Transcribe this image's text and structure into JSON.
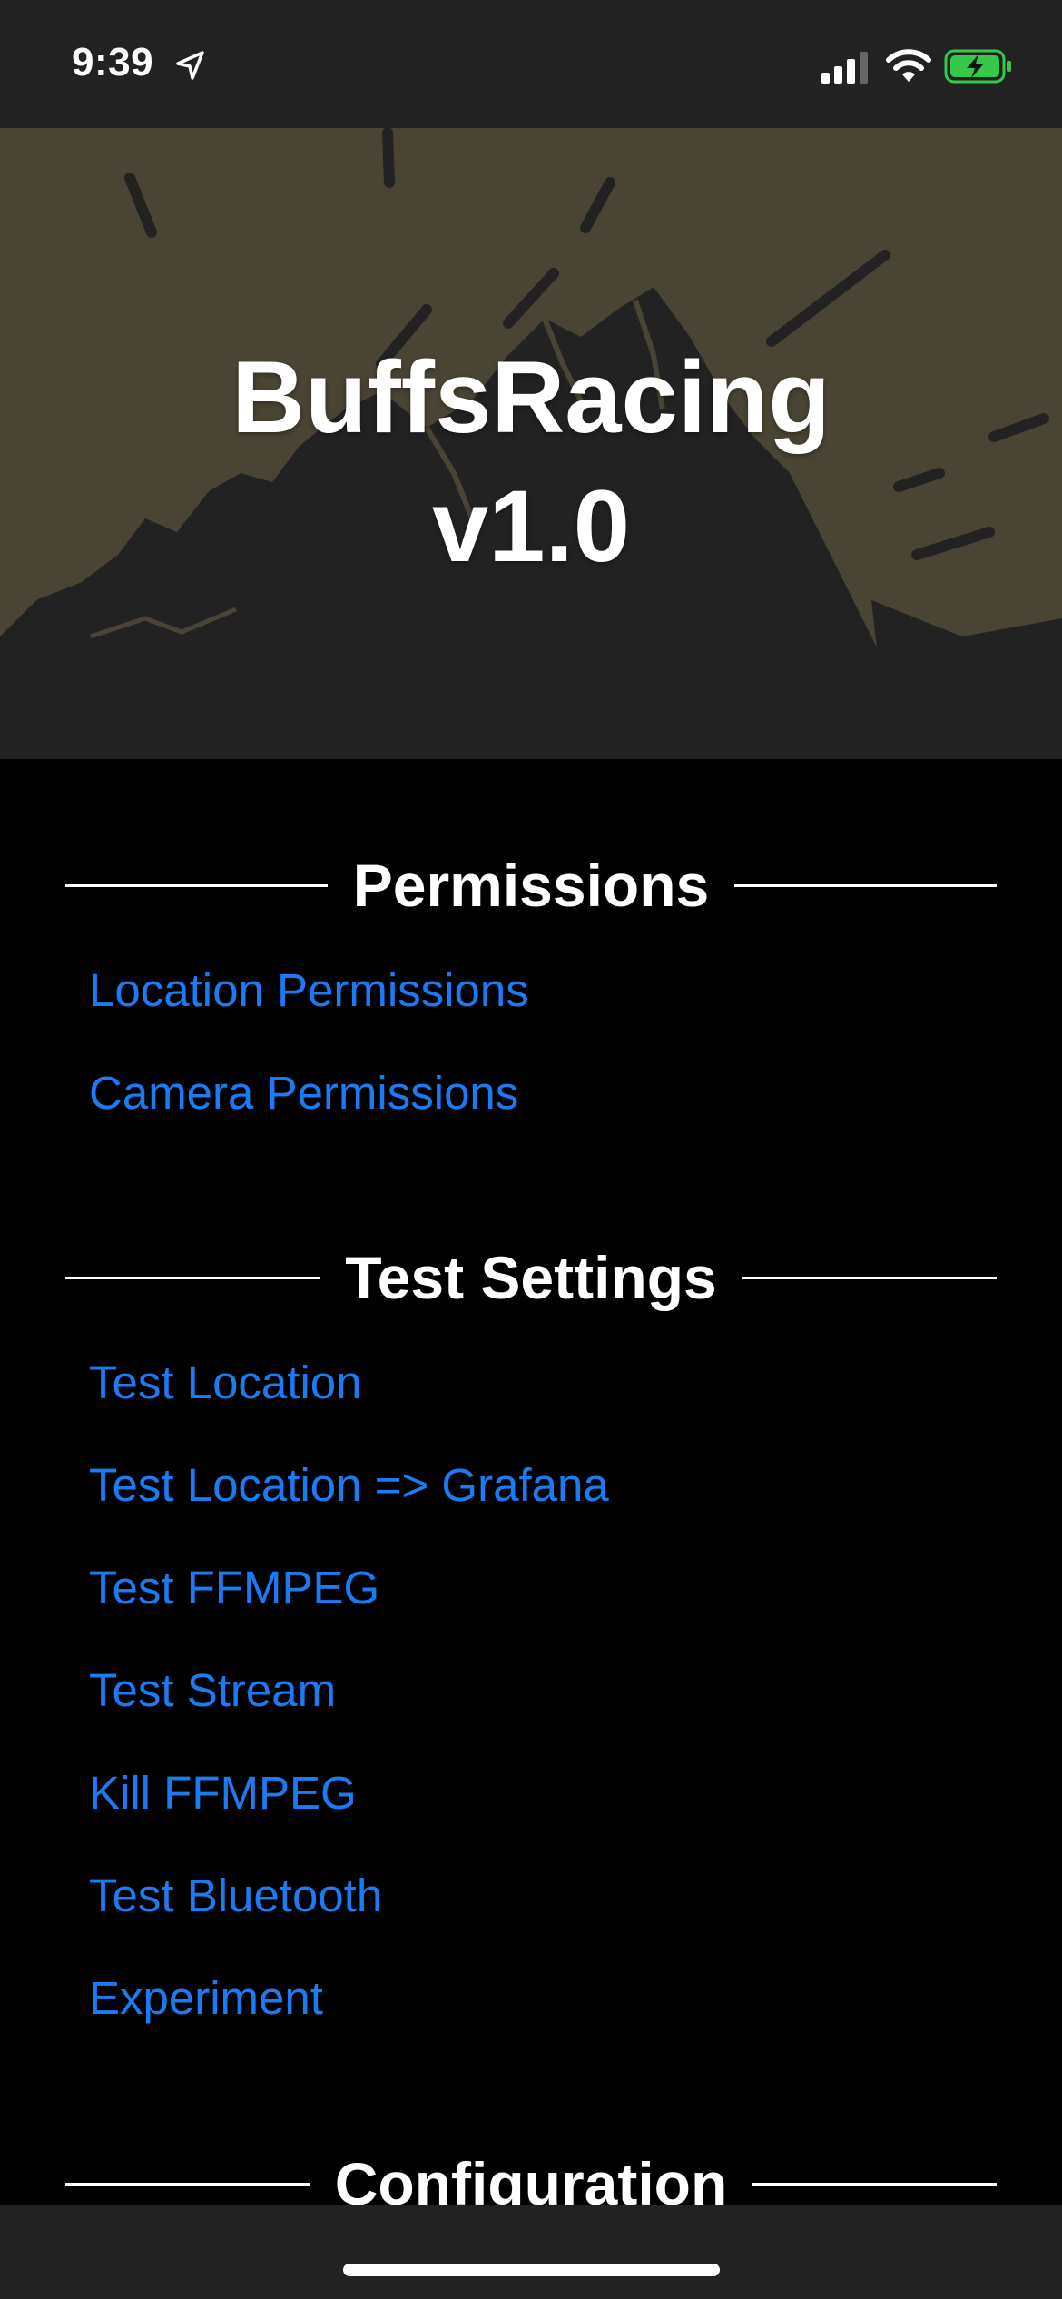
{
  "status_bar": {
    "time": "9:39",
    "battery_color": "#35c84a"
  },
  "banner": {
    "title_line1": "BuffsRacing",
    "title_line2": "v1.0",
    "background_color": "#494433"
  },
  "sections": {
    "permissions": {
      "title": "Permissions",
      "items": [
        "Location Permissions",
        "Camera Permissions"
      ]
    },
    "test_settings": {
      "title": "Test Settings",
      "items": [
        "Test Location",
        "Test Location => Grafana",
        "Test FFMPEG",
        "Test Stream",
        "Kill FFMPEG",
        "Test Bluetooth",
        "Experiment"
      ]
    },
    "configuration": {
      "title": "Configuration"
    }
  },
  "colors": {
    "link": "#1a7cf4",
    "background": "#000000",
    "bars": "#222222"
  }
}
